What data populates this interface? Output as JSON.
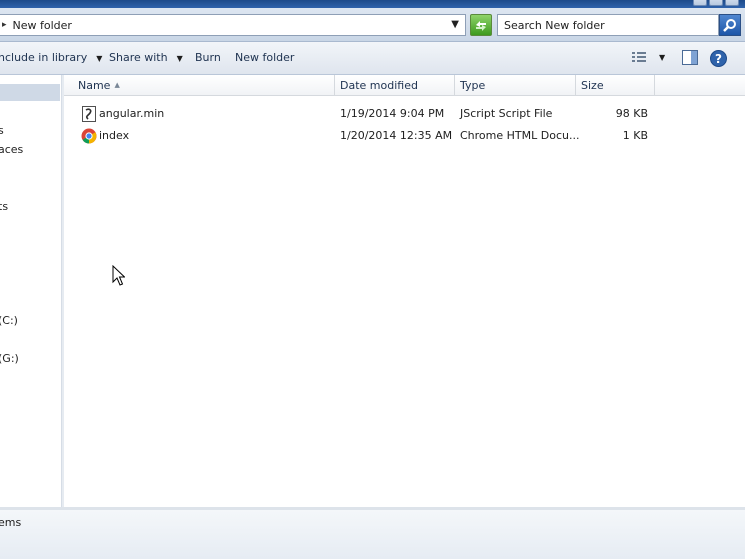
{
  "address": {
    "current_folder": "New folder",
    "refresh_icon": "refresh-arrows-icon"
  },
  "search": {
    "placeholder": "Search New folder"
  },
  "toolbar": {
    "include_in_library": "nclude in library",
    "share_with": "Share with",
    "burn": "Burn",
    "new_folder": "New folder"
  },
  "navigation": {
    "items": [
      {
        "label": "s"
      },
      {
        "label": "aces"
      },
      {
        "label": "ts"
      },
      {
        "label": "(C:)"
      },
      {
        "label": "(G:)"
      }
    ]
  },
  "columns": {
    "name": "Name",
    "date_modified": "Date modified",
    "type": "Type",
    "size": "Size"
  },
  "files": [
    {
      "name": "angular.min",
      "date": "1/19/2014 9:04 PM",
      "type": "JScript Script File",
      "size": "98 KB",
      "icon": "jscript-file-icon"
    },
    {
      "name": "index",
      "date": "1/20/2014 12:35 AM",
      "type": "Chrome HTML Docu...",
      "size": "1 KB",
      "icon": "chrome-html-icon"
    }
  ],
  "status": {
    "item_count": "ems"
  },
  "colors": {
    "accent": "#2f63ab",
    "toolbar_text": "#1e3250"
  }
}
